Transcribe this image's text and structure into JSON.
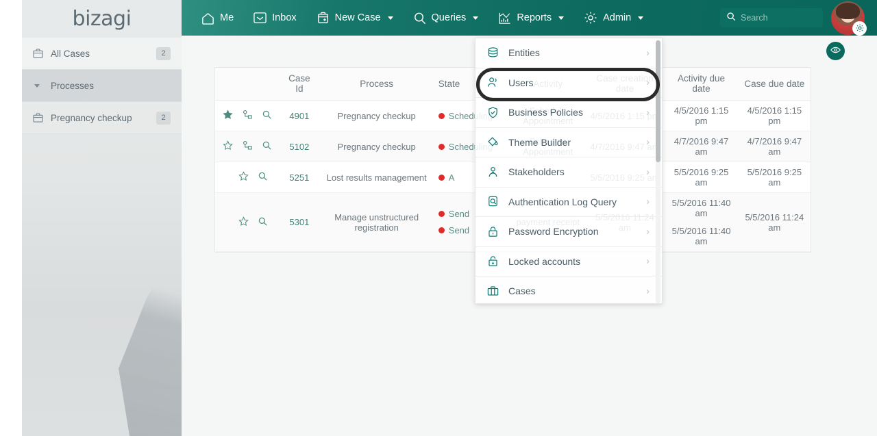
{
  "brand": {
    "name": "bizagi"
  },
  "sidebar": {
    "items": [
      {
        "label": "All Cases",
        "badge": "2",
        "icon": "briefcase-icon",
        "type": "plain"
      },
      {
        "label": "Processes",
        "badge": "",
        "icon": "caret-down-icon",
        "type": "group"
      },
      {
        "label": "Pregnancy checkup",
        "badge": "2",
        "icon": "briefcase-icon",
        "type": "child"
      }
    ]
  },
  "header": {
    "nav": [
      {
        "label": "Me",
        "icon": "home-icon",
        "caret": false
      },
      {
        "label": "Inbox",
        "icon": "inbox-icon",
        "caret": false
      },
      {
        "label": "New Case",
        "icon": "new-case-icon",
        "caret": true
      },
      {
        "label": "Queries",
        "icon": "search-icon",
        "caret": true
      },
      {
        "label": "Reports",
        "icon": "chart-icon",
        "caret": true
      },
      {
        "label": "Admin",
        "icon": "gear-icon",
        "caret": true
      }
    ],
    "search": {
      "value": "",
      "placeholder": "Search"
    },
    "avatar": {
      "name": "user-avatar",
      "gear": "gear-icon"
    },
    "accent_color": "#0b6a5e"
  },
  "content": {
    "eye_button": "eye-icon",
    "table": {
      "columns": [
        "",
        "Case Id",
        "Process",
        "State",
        "Activity",
        "Case creation date",
        "Activity due date",
        "Case due date"
      ],
      "rows": [
        {
          "actions": [
            "star-filled-icon",
            "workflow-icon",
            "magnifier-icon"
          ],
          "case_id": "4901",
          "process": "Pregnancy checkup",
          "states": [
            "Scheduling"
          ],
          "activity": "Schedule Appointment",
          "creation_date": "4/5/2016 1:15 pm",
          "activity_due": "4/5/2016 1:15 pm",
          "case_due": "4/5/2016 1:15 pm"
        },
        {
          "actions": [
            "star-outline-icon",
            "workflow-icon",
            "magnifier-icon"
          ],
          "case_id": "5102",
          "process": "Pregnancy checkup",
          "states": [
            "Scheduling"
          ],
          "activity": "Schedule Appointment",
          "creation_date": "4/7/2016 9:47 am",
          "activity_due": "4/7/2016 9:47 am",
          "case_due": "4/7/2016 9:47 am"
        },
        {
          "actions": [
            "star-outline-icon",
            "magnifier-icon"
          ],
          "case_id": "5251",
          "process": "Lost results management",
          "states": [
            "A"
          ],
          "activity": "",
          "creation_date": "5/5/2016 9:25 am",
          "activity_due": "5/5/2016 9:25 am",
          "case_due": "5/5/2016 9:25 am"
        },
        {
          "actions": [
            "star-outline-icon",
            "magnifier-icon"
          ],
          "case_id": "5301",
          "process": "Manage unstructured registration",
          "states": [
            "Send",
            "Send"
          ],
          "activity": "payment receipt",
          "creation_date": "5/5/2016 11:24 am",
          "activity_due": "5/5/2016 11:40 am\n5/5/2016 11:40 am",
          "activity_due_1": "5/5/2016 11:40 am",
          "activity_due_2": "5/5/2016 11:40 am",
          "case_due": "5/5/2016 11:24 am"
        }
      ]
    }
  },
  "admin_menu": {
    "open": true,
    "highlighted_item": "Users",
    "items": [
      {
        "label": "Entities",
        "icon": "database-icon"
      },
      {
        "label": "Users",
        "icon": "users-icon"
      },
      {
        "label": "Business Policies",
        "icon": "shield-check-icon"
      },
      {
        "label": "Theme Builder",
        "icon": "paint-bucket-icon"
      },
      {
        "label": "Stakeholders",
        "icon": "stakeholders-icon"
      },
      {
        "label": "Authentication Log Query",
        "icon": "log-search-icon"
      },
      {
        "label": "Password Encryption",
        "icon": "lock-closed-icon"
      },
      {
        "label": "Locked accounts",
        "icon": "lock-open-icon"
      },
      {
        "label": "Cases",
        "icon": "briefcase-icon"
      }
    ],
    "arrow": "›"
  }
}
